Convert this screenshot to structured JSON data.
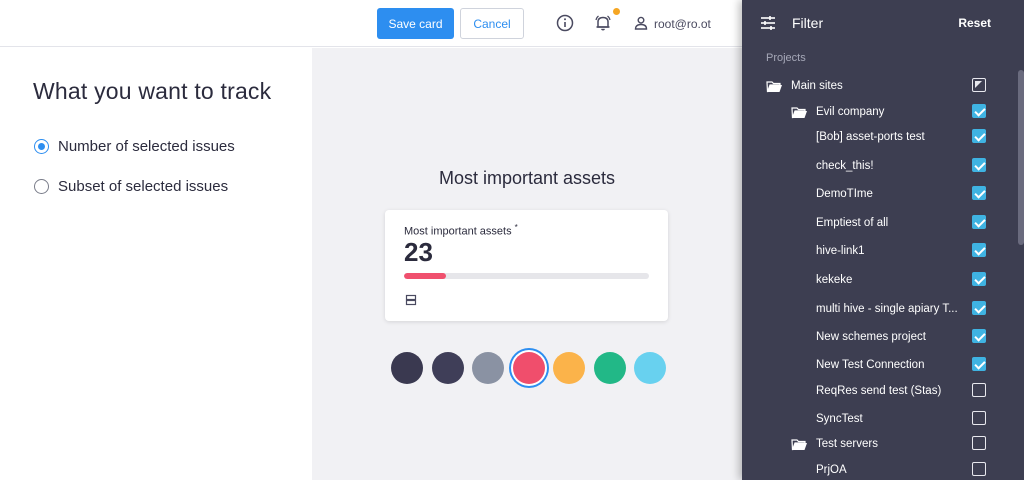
{
  "topbar": {
    "save_label": "Save card",
    "cancel_label": "Cancel",
    "user": "root@ro.ot",
    "icons": [
      "info-icon",
      "bell-icon",
      "user-icon"
    ],
    "notification_dot_color": "#f5a623"
  },
  "left": {
    "heading": "What you want to track",
    "options": [
      {
        "label": "Number of selected issues",
        "selected": true
      },
      {
        "label": "Subset of selected issues",
        "selected": false
      }
    ]
  },
  "preview": {
    "title": "Most important assets",
    "card": {
      "title": "Most important assets",
      "asterisk": "*",
      "value": "23",
      "progress_fraction": 0.17,
      "progress_color": "#f0506e",
      "icon": "server-icon"
    },
    "colors": [
      {
        "hex": "#3a3950",
        "selected": false
      },
      {
        "hex": "#3f3e58",
        "selected": false
      },
      {
        "hex": "#8a92a3",
        "selected": false
      },
      {
        "hex": "#f04e6c",
        "selected": true
      },
      {
        "hex": "#fbb34a",
        "selected": false
      },
      {
        "hex": "#22b887",
        "selected": false
      },
      {
        "hex": "#68d1ef",
        "selected": false
      }
    ]
  },
  "filter": {
    "title": "Filter",
    "reset_label": "Reset",
    "section_label": "Projects",
    "items": [
      {
        "label": "Main sites",
        "level": 0,
        "folder": true,
        "state": "partial"
      },
      {
        "label": "Evil company",
        "level": 1,
        "folder": true,
        "state": "checked"
      },
      {
        "label": "[Bob] asset-ports test",
        "level": 2,
        "folder": false,
        "state": "checked"
      },
      {
        "label": "check_this!",
        "level": 2,
        "folder": false,
        "state": "checked"
      },
      {
        "label": "DemoTIme",
        "level": 2,
        "folder": false,
        "state": "checked"
      },
      {
        "label": "Emptiest of all",
        "level": 2,
        "folder": false,
        "state": "checked"
      },
      {
        "label": "hive-link1",
        "level": 2,
        "folder": false,
        "state": "checked"
      },
      {
        "label": "kekeke",
        "level": 2,
        "folder": false,
        "state": "checked"
      },
      {
        "label": "multi hive - single apiary T...",
        "level": 2,
        "folder": false,
        "state": "checked"
      },
      {
        "label": "New schemes project",
        "level": 2,
        "folder": false,
        "state": "checked"
      },
      {
        "label": "New Test Connection",
        "level": 2,
        "folder": false,
        "state": "checked"
      },
      {
        "label": "ReqRes send test (Stas)",
        "level": 1,
        "folder": false,
        "state": "unchecked"
      },
      {
        "label": "SyncTest",
        "level": 1,
        "folder": false,
        "state": "unchecked"
      },
      {
        "label": "Test servers",
        "level": 1,
        "folder": true,
        "state": "unchecked"
      },
      {
        "label": "PrjOA",
        "level": 2,
        "folder": false,
        "state": "unchecked"
      }
    ]
  }
}
